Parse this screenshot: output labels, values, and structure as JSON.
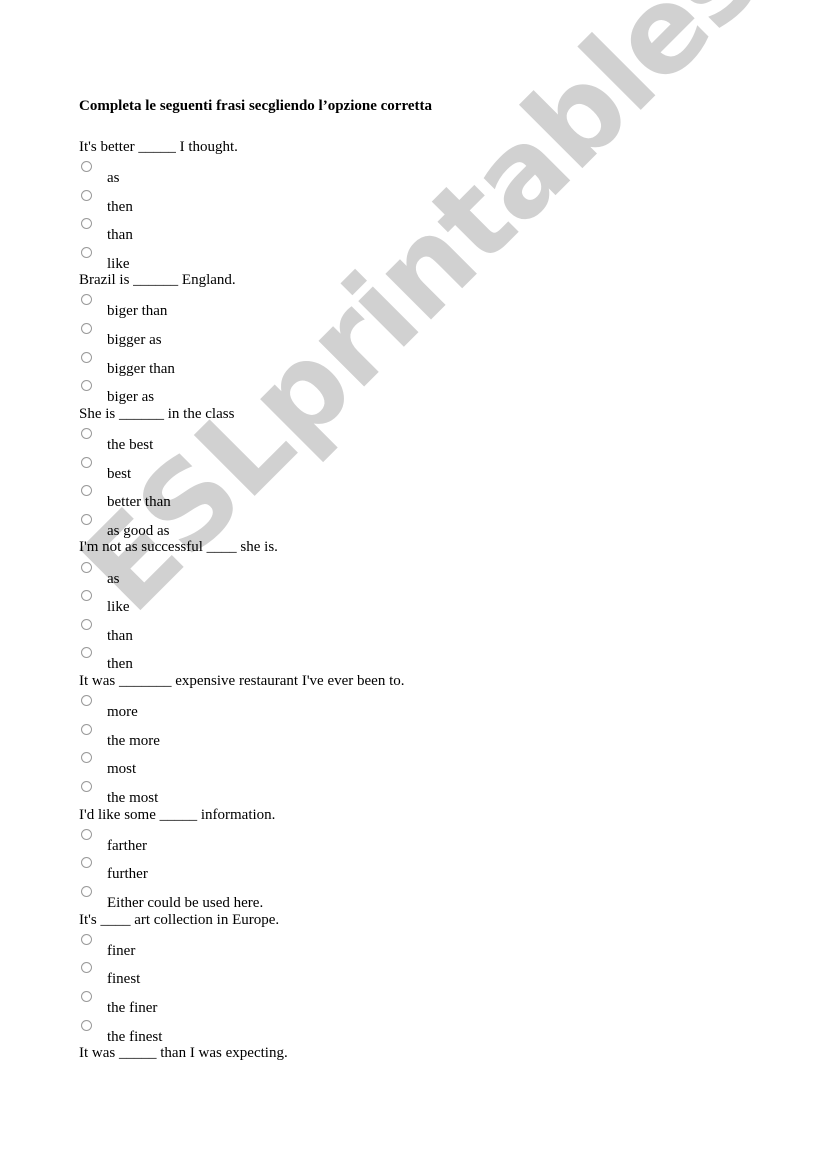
{
  "document": {
    "title": "Completa le seguenti frasi secgliendo l’opzione corretta",
    "watermark": "ESLprintables.com",
    "questions": [
      {
        "text": "It's better _____ I thought.",
        "options": [
          "as",
          "then",
          "than",
          "like"
        ]
      },
      {
        "text": " Brazil is ______ England.",
        "options": [
          "biger than",
          "bigger as",
          "bigger than",
          "biger as"
        ]
      },
      {
        "text": "She is ______ in the class",
        "options": [
          "the best",
          "best",
          "better than",
          "as good as"
        ]
      },
      {
        "text": "I'm not as successful ____ she is.",
        "options": [
          "as",
          "like",
          "than",
          "then"
        ]
      },
      {
        "text": "It was _______ expensive restaurant I've ever been to.",
        "options": [
          "more",
          "the more",
          "most",
          "the most"
        ]
      },
      {
        "text": " I'd like some _____ information.",
        "options": [
          "farther",
          "further",
          "Either could be used here."
        ]
      },
      {
        "text": "It's  ____ art collection in Europe.",
        "options": [
          "finer",
          "finest",
          "the finer",
          "the finest"
        ]
      },
      {
        "text": "It was _____ than I was expecting.",
        "options": []
      }
    ]
  }
}
